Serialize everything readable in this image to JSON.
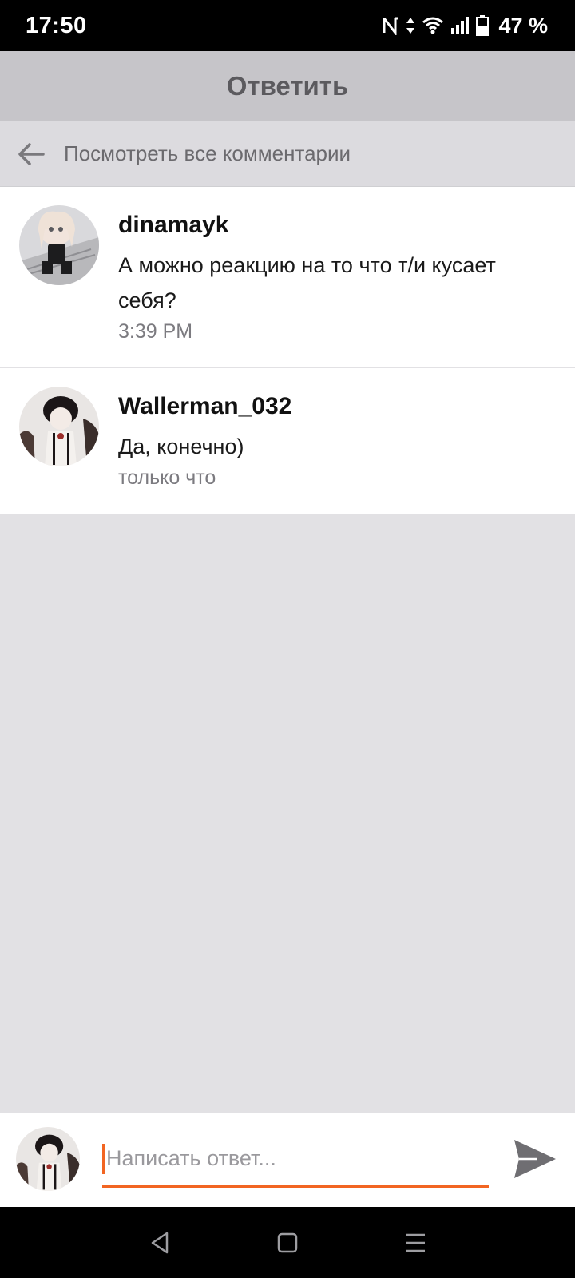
{
  "status_bar": {
    "time": "17:50",
    "battery": "47 %",
    "icons": [
      "nfc-icon",
      "data-arrows-icon",
      "wifi-icon",
      "signal-icon",
      "battery-icon"
    ]
  },
  "header": {
    "title": "Ответить"
  },
  "view_all": {
    "label": "Посмотреть все комментарии",
    "icon": "back-arrow-icon"
  },
  "comments": [
    {
      "username": "dinamayk",
      "text": "А можно реакцию на то что т/и кусает себя?",
      "time": "3:39 PM"
    },
    {
      "username": "Wallerman_032",
      "text": "Да, конечно)",
      "time": "только что"
    }
  ],
  "reply": {
    "placeholder": "Написать ответ...",
    "value": "",
    "send_icon": "send-icon"
  },
  "nav": {
    "icons": [
      "back-nav-icon",
      "home-nav-icon",
      "menu-nav-icon"
    ]
  },
  "colors": {
    "accent": "#f26522",
    "header_bg": "#c6c5c9",
    "page_bg": "#e2e1e4"
  }
}
